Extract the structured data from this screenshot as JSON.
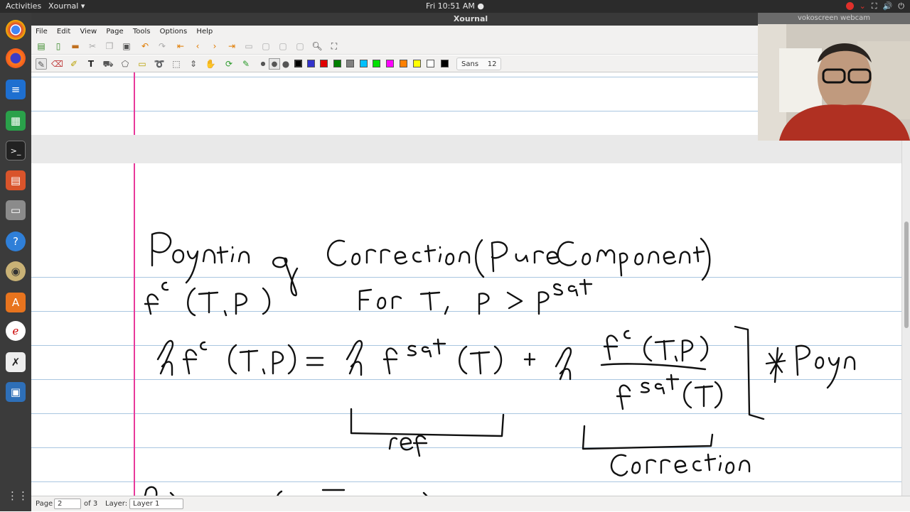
{
  "topbar": {
    "activities": "Activities",
    "app_name": "Xournal ▾",
    "clock": "Fri 10:51 AM ●",
    "record_color": "#e0302b"
  },
  "window": {
    "title": "Xournal"
  },
  "menus": [
    "File",
    "Edit",
    "View",
    "Page",
    "Tools",
    "Options",
    "Help"
  ],
  "toolbar": {
    "font_name": "Sans",
    "font_size": "12",
    "colors": [
      "#000000",
      "#3333cc",
      "#e00000",
      "#008000",
      "#808080",
      "#00c0ff",
      "#00e000",
      "#ff00ff",
      "#ff8000",
      "#ffff00",
      "#ffffff",
      "#000000"
    ]
  },
  "notebook": {
    "rule_color": "#a9c6e0",
    "margin_color": "#e8399a"
  },
  "status": {
    "page_label": "Page",
    "page_value": "2",
    "page_of": "of 3",
    "layer_label": "Layer:",
    "layer_value": "Layer 1"
  },
  "webcam": {
    "label": "vokoscreen webcam"
  },
  "dock": [
    "chrome-icon",
    "firefox-icon",
    "writer-icon",
    "calc-icon",
    "terminal-icon",
    "impress-icon",
    "files-icon",
    "help-icon",
    "speaker-icon",
    "software-icon",
    "xournal-icon",
    "xournal-pen-icon",
    "screenshot-icon"
  ]
}
